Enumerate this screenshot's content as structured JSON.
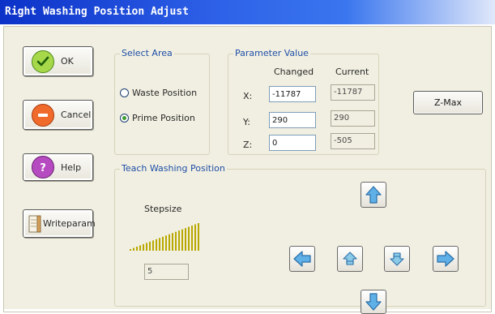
{
  "window": {
    "title": "Right Washing Position Adjust"
  },
  "buttons": {
    "ok": "OK",
    "cancel": "Cancel",
    "help": "Help",
    "writeparam": "Writeparam",
    "zmax": "Z-Max"
  },
  "select_area": {
    "title": "Select Area",
    "options": [
      "Waste Position",
      "Prime Position"
    ],
    "selected": "Prime Position"
  },
  "parameter_value": {
    "title": "Parameter Value",
    "col_changed": "Changed",
    "col_current": "Current",
    "rows": [
      {
        "axis": "X:",
        "changed": "-11787",
        "current": "-11787"
      },
      {
        "axis": "Y:",
        "changed": "290",
        "current": "290"
      },
      {
        "axis": "Z:",
        "changed": "0",
        "current": "-505"
      }
    ]
  },
  "teach": {
    "title": "Teach Washing Position",
    "stepsize_label": "Stepsize",
    "stepsize_value": "5",
    "stepsize_level_fraction": 0.5,
    "arrows": [
      "arrow-up-icon",
      "arrow-down-icon",
      "arrow-left-icon",
      "arrow-right-icon",
      "z-up-icon",
      "z-down-icon"
    ]
  },
  "colors": {
    "title_bar": "#0c32c8",
    "dialog_bg": "#f1efe1",
    "group_title": "#1f4fa8",
    "arrow_blue": "#4aa0dc",
    "stepsize_bar": "#b9a800"
  }
}
